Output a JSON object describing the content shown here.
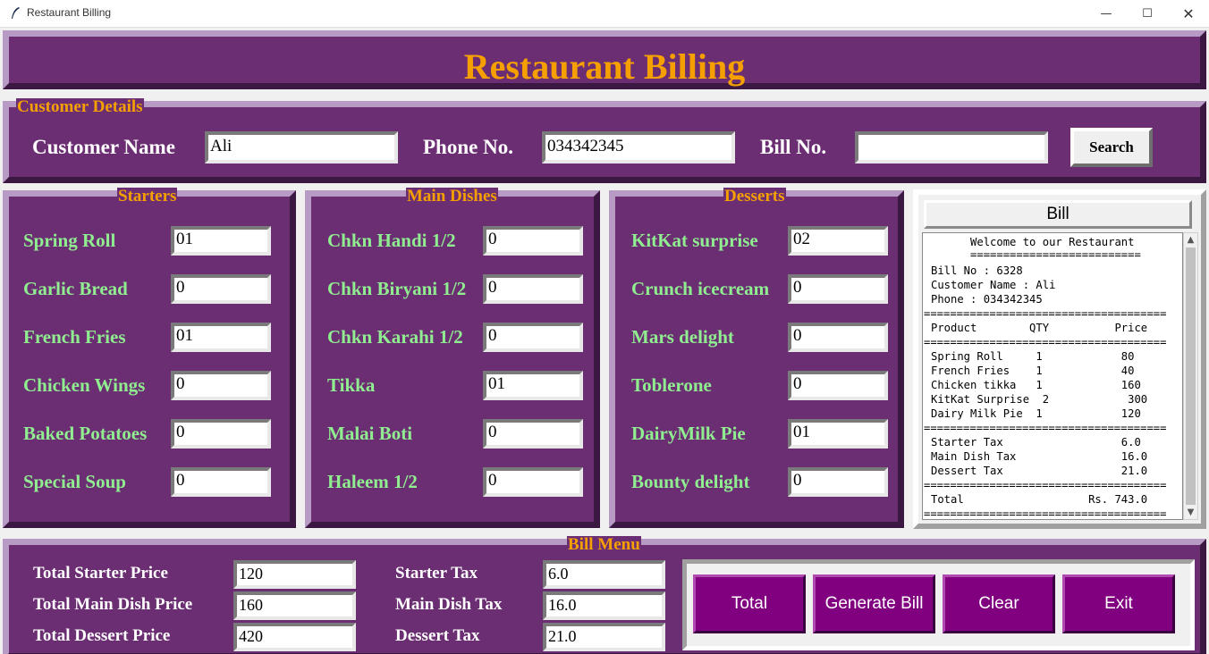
{
  "window": {
    "title": "Restaurant Billing",
    "minimize_icon": "minimize-icon",
    "maximize_icon": "maximize-icon",
    "close_icon": "close-icon"
  },
  "header": {
    "title": "Restaurant Billing"
  },
  "customer": {
    "legend": "Customer Details",
    "name_label": "Customer Name",
    "name_value": "Ali",
    "phone_label": "Phone No.",
    "phone_value": "034342345",
    "bill_label": "Bill No.",
    "bill_value": "",
    "search_label": "Search"
  },
  "starters": {
    "legend": "Starters",
    "items": [
      {
        "label": "Spring Roll",
        "qty": "01"
      },
      {
        "label": "Garlic Bread",
        "qty": "0"
      },
      {
        "label": "French Fries",
        "qty": "01"
      },
      {
        "label": "Chicken Wings",
        "qty": "0"
      },
      {
        "label": "Baked Potatoes",
        "qty": "0"
      },
      {
        "label": "Special Soup",
        "qty": "0"
      }
    ]
  },
  "main_dishes": {
    "legend": "Main Dishes",
    "items": [
      {
        "label": "Chkn Handi 1/2",
        "qty": "0"
      },
      {
        "label": "Chkn Biryani 1/2",
        "qty": "0"
      },
      {
        "label": "Chkn Karahi 1/2",
        "qty": "0"
      },
      {
        "label": "Tikka",
        "qty": "01"
      },
      {
        "label": "Malai Boti",
        "qty": "0"
      },
      {
        "label": "Haleem 1/2",
        "qty": "0"
      }
    ]
  },
  "desserts": {
    "legend": "Desserts",
    "items": [
      {
        "label": "KitKat surprise",
        "qty": "02"
      },
      {
        "label": "Crunch icecream",
        "qty": "0"
      },
      {
        "label": "Mars delight",
        "qty": "0"
      },
      {
        "label": "Toblerone",
        "qty": "0"
      },
      {
        "label": "DairyMilk Pie",
        "qty": "01"
      },
      {
        "label": "Bounty delight",
        "qty": "0"
      }
    ]
  },
  "bill": {
    "title": "Bill",
    "lines": [
      "      Welcome to our Restaurant",
      "      ==========================",
      "Bill No : 6328",
      "Customer Name : Ali",
      "Phone : 034342345",
      "=====================================",
      "Product        QTY          Price",
      "=====================================",
      "Spring Roll     1            80",
      "French Fries    1            40",
      "Chicken tikka   1            160",
      "KitKat Surprise  2            300",
      "Dairy Milk Pie  1            120",
      "=====================================",
      "Starter Tax                  6.0",
      "Main Dish Tax                16.0",
      "Dessert Tax                  21.0",
      "=====================================",
      "Total                   Rs. 743.0",
      "====================================="
    ]
  },
  "bill_menu": {
    "legend": "Bill Menu",
    "totals": [
      {
        "label": "Total Starter Price",
        "value": "120"
      },
      {
        "label": "Total Main Dish Price",
        "value": "160"
      },
      {
        "label": "Total Dessert Price",
        "value": "420"
      }
    ],
    "taxes": [
      {
        "label": "Starter Tax",
        "value": "6.0"
      },
      {
        "label": "Main Dish Tax",
        "value": "16.0"
      },
      {
        "label": "Dessert Tax",
        "value": "21.0"
      }
    ],
    "buttons": {
      "total": "Total",
      "generate": "Generate Bill",
      "clear": "Clear",
      "exit": "Exit"
    }
  },
  "colors": {
    "panel": "#6b2e73",
    "accent": "#f5a000",
    "item_label": "#90ee90",
    "button": "#800080"
  }
}
